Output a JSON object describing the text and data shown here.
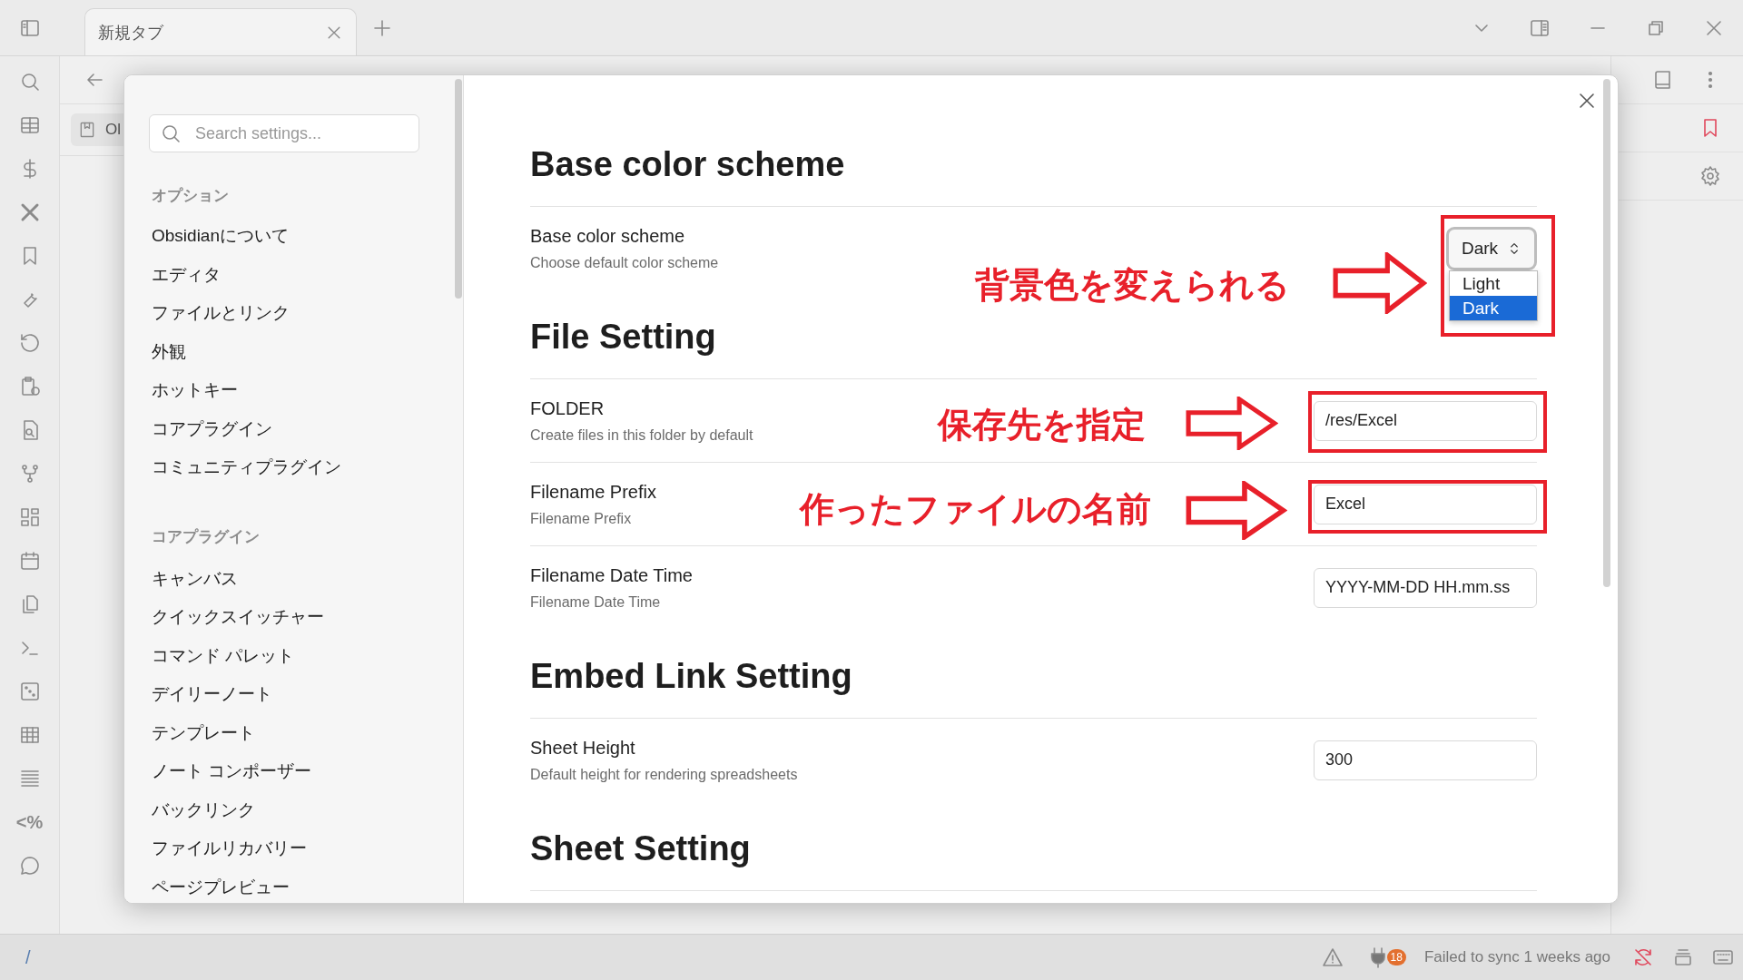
{
  "window": {
    "tabs": [
      {
        "title": "新規タブ",
        "selected": true
      }
    ]
  },
  "workspace": {
    "chip": "Ol"
  },
  "ribbon": {
    "templater_glyph": "<%"
  },
  "settings_sidebar": {
    "search": {
      "placeholder": "Search settings..."
    },
    "groups": [
      {
        "heading": "オプション",
        "items": [
          {
            "label": "Obsidianについて",
            "selected": false
          },
          {
            "label": "エディタ",
            "selected": false
          },
          {
            "label": "ファイルとリンク",
            "selected": false
          },
          {
            "label": "外観",
            "selected": false
          },
          {
            "label": "ホットキー",
            "selected": false
          },
          {
            "label": "コアプラグイン",
            "selected": false
          },
          {
            "label": "コミュニティプラグイン",
            "selected": false
          }
        ]
      },
      {
        "heading": "コアプラグイン",
        "items": [
          {
            "label": "キャンバス",
            "selected": false
          },
          {
            "label": "クイックスイッチャー",
            "selected": false
          },
          {
            "label": "コマンド パレット",
            "selected": false
          },
          {
            "label": "デイリーノート",
            "selected": false
          },
          {
            "label": "テンプレート",
            "selected": false
          },
          {
            "label": "ノート コンポーザー",
            "selected": false
          },
          {
            "label": "バックリンク",
            "selected": false
          },
          {
            "label": "ファイルリカバリー",
            "selected": false
          },
          {
            "label": "ページプレビュー",
            "selected": false
          }
        ]
      }
    ]
  },
  "settings": {
    "sections": [
      {
        "heading": "Base color scheme",
        "settings": [
          {
            "kind": "dropdown",
            "name": "Base color scheme",
            "description": "Choose default color scheme",
            "value": "Dark",
            "options": [
              {
                "label": "Light",
                "selected": false
              },
              {
                "label": "Dark",
                "selected": true
              }
            ]
          }
        ]
      },
      {
        "heading": "File Setting",
        "settings": [
          {
            "kind": "text",
            "name": "FOLDER",
            "description": "Create files in this folder by default",
            "value": "/res/Excel"
          },
          {
            "kind": "text",
            "name": "Filename Prefix",
            "description": "Filename Prefix",
            "value": "Excel"
          },
          {
            "kind": "text",
            "name": "Filename Date Time",
            "description": "Filename Date Time",
            "value": "YYYY-MM-DD HH.mm.ss"
          }
        ]
      },
      {
        "heading": "Embed Link Setting",
        "settings": [
          {
            "kind": "text",
            "name": "Sheet Height",
            "description": "Default height for rendering spreadsheets",
            "value": "300"
          }
        ]
      },
      {
        "heading": "Sheet Setting"
      }
    ]
  },
  "annotations": [
    {
      "text": "背景色を変えられる"
    },
    {
      "text": "保存先を指定"
    },
    {
      "text": "作ったファイルの名前"
    }
  ],
  "status_bar": {
    "path": "/",
    "plugin_badge": "18",
    "sync_text": "Failed to sync 1 weeks ago"
  }
}
